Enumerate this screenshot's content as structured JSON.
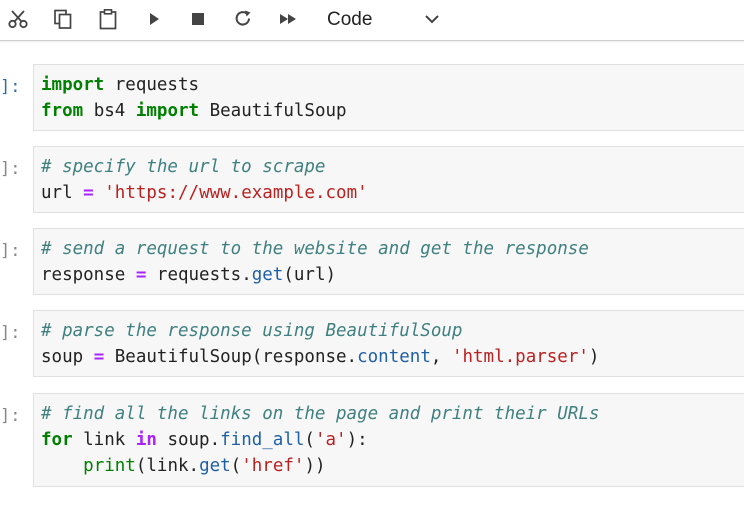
{
  "toolbar": {
    "buttons": [
      {
        "icon": "scissors-icon",
        "action": "cut"
      },
      {
        "icon": "copy-icon",
        "action": "copy"
      },
      {
        "icon": "clipboard-icon",
        "action": "paste"
      },
      {
        "icon": "play-icon",
        "action": "run"
      },
      {
        "icon": "stop-icon",
        "action": "interrupt"
      },
      {
        "icon": "refresh-icon",
        "action": "restart"
      },
      {
        "icon": "fast-forward-icon",
        "action": "restart-run-all"
      }
    ],
    "cell_type": "Code"
  },
  "colors": {
    "keyword": "#008000",
    "comment": "#408080",
    "string": "#ba2121",
    "operator": "#aa22ff",
    "attribute": "#1f5fa5",
    "cell_bg": "#f7f7f7",
    "prompt": "#888888",
    "prompt_active": "#2f6fa8"
  },
  "cells": [
    {
      "prompt": "]:",
      "lines": [
        [
          {
            "t": "kw",
            "v": "import"
          },
          {
            "t": "n",
            "v": " requests"
          }
        ],
        [
          {
            "t": "kw",
            "v": "from"
          },
          {
            "t": "n",
            "v": " bs4 "
          },
          {
            "t": "kw",
            "v": "import"
          },
          {
            "t": "n",
            "v": " BeautifulSoup"
          }
        ]
      ]
    },
    {
      "prompt": "]:",
      "lines": [
        [
          {
            "t": "cm",
            "v": "# specify the url to scrape"
          }
        ],
        [
          {
            "t": "n",
            "v": "url "
          },
          {
            "t": "op",
            "v": "="
          },
          {
            "t": "n",
            "v": " "
          },
          {
            "t": "st",
            "v": "'https://www.example.com'"
          }
        ]
      ]
    },
    {
      "prompt": "]:",
      "lines": [
        [
          {
            "t": "cm",
            "v": "# send a request to the website and get the response"
          }
        ],
        [
          {
            "t": "n",
            "v": "response "
          },
          {
            "t": "op",
            "v": "="
          },
          {
            "t": "n",
            "v": " requests."
          },
          {
            "t": "at",
            "v": "get"
          },
          {
            "t": "n",
            "v": "(url)"
          }
        ]
      ]
    },
    {
      "prompt": "]:",
      "lines": [
        [
          {
            "t": "cm",
            "v": "# parse the response using BeautifulSoup"
          }
        ],
        [
          {
            "t": "n",
            "v": "soup "
          },
          {
            "t": "op",
            "v": "="
          },
          {
            "t": "n",
            "v": " BeautifulSoup(response."
          },
          {
            "t": "at",
            "v": "content"
          },
          {
            "t": "n",
            "v": ", "
          },
          {
            "t": "st",
            "v": "'html.parser'"
          },
          {
            "t": "n",
            "v": ")"
          }
        ]
      ]
    },
    {
      "prompt": "]:",
      "lines": [
        [
          {
            "t": "cm",
            "v": "# find all the links on the page and print their URLs"
          }
        ],
        [
          {
            "t": "kw",
            "v": "for"
          },
          {
            "t": "n",
            "v": " link "
          },
          {
            "t": "op",
            "v": "in"
          },
          {
            "t": "n",
            "v": " soup."
          },
          {
            "t": "at",
            "v": "find_all"
          },
          {
            "t": "n",
            "v": "("
          },
          {
            "t": "st",
            "v": "'a'"
          },
          {
            "t": "n",
            "v": "):"
          }
        ],
        [
          {
            "t": "n",
            "v": "    "
          },
          {
            "t": "bi",
            "v": "print"
          },
          {
            "t": "n",
            "v": "(link."
          },
          {
            "t": "at",
            "v": "get"
          },
          {
            "t": "n",
            "v": "("
          },
          {
            "t": "st",
            "v": "'href'"
          },
          {
            "t": "n",
            "v": "))"
          }
        ]
      ]
    }
  ]
}
